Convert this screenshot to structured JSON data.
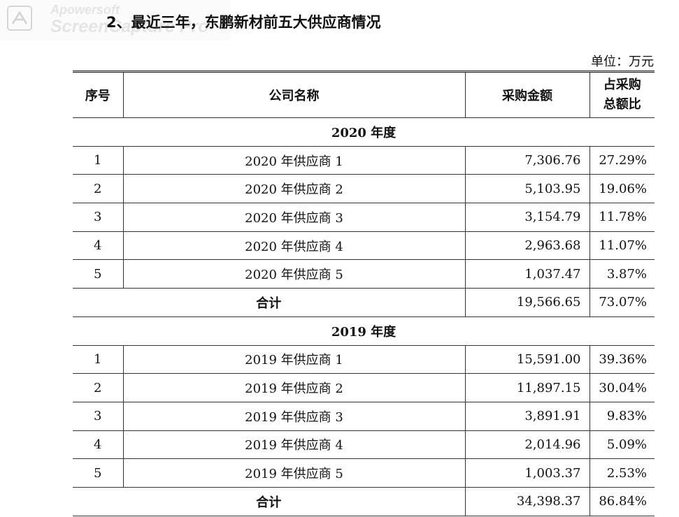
{
  "watermark": {
    "line1": "Apowersoft",
    "line2": "ScreenCapture Pro"
  },
  "title": "2、最近三年，东鹏新材前五大供应商情况",
  "unit": "单位：万元",
  "table": {
    "headers": {
      "index": "序号",
      "company": "公司名称",
      "amount": "采购金额",
      "ratio_line1": "占采购",
      "ratio_line2": "总额比"
    },
    "sections": [
      {
        "year_label": "2020 年度",
        "rows": [
          {
            "index": "1",
            "company": "2020 年供应商 1",
            "amount": "7,306.76",
            "ratio": "27.29%"
          },
          {
            "index": "2",
            "company": "2020 年供应商 2",
            "amount": "5,103.95",
            "ratio": "19.06%"
          },
          {
            "index": "3",
            "company": "2020 年供应商 3",
            "amount": "3,154.79",
            "ratio": "11.78%"
          },
          {
            "index": "4",
            "company": "2020 年供应商 4",
            "amount": "2,963.68",
            "ratio": "11.07%"
          },
          {
            "index": "5",
            "company": "2020 年供应商 5",
            "amount": "1,037.47",
            "ratio": "3.87%"
          }
        ],
        "total_label": "合计",
        "total_amount": "19,566.65",
        "total_ratio": "73.07%"
      },
      {
        "year_label": "2019 年度",
        "rows": [
          {
            "index": "1",
            "company": "2019 年供应商 1",
            "amount": "15,591.00",
            "ratio": "39.36%"
          },
          {
            "index": "2",
            "company": "2019 年供应商 2",
            "amount": "11,897.15",
            "ratio": "30.04%"
          },
          {
            "index": "3",
            "company": "2019 年供应商 3",
            "amount": "3,891.91",
            "ratio": "9.83%"
          },
          {
            "index": "4",
            "company": "2019 年供应商 4",
            "amount": "2,014.96",
            "ratio": "5.09%"
          },
          {
            "index": "5",
            "company": "2019 年供应商 5",
            "amount": "1,003.37",
            "ratio": "2.53%"
          }
        ],
        "total_label": "合计",
        "total_amount": "34,398.37",
        "total_ratio": "86.84%"
      }
    ]
  }
}
